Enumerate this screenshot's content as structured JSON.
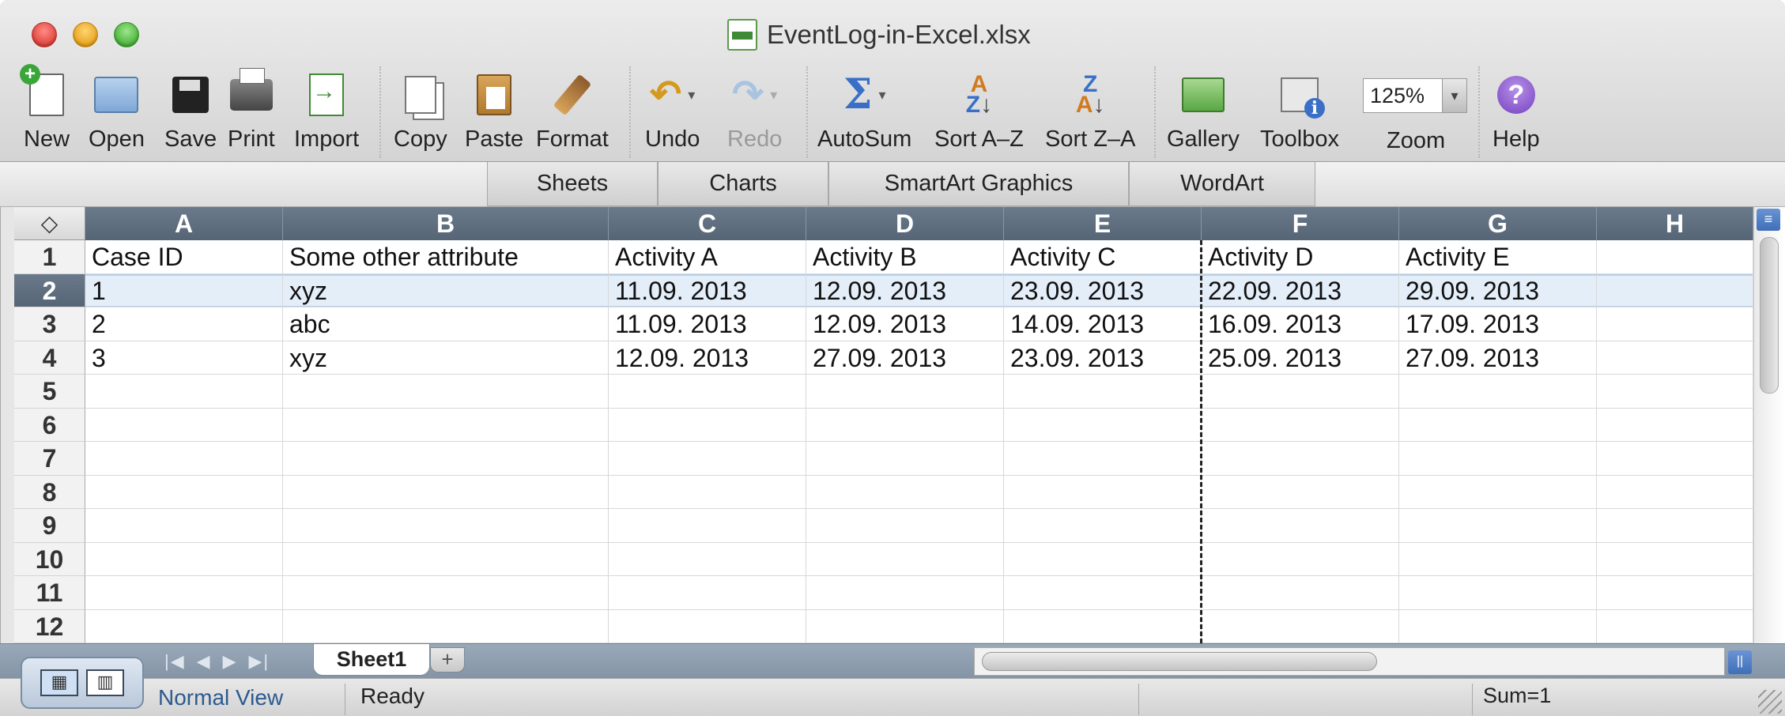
{
  "window": {
    "title": "EventLog-in-Excel.xlsx"
  },
  "toolbar": {
    "items": [
      {
        "label": "New",
        "icon": "new-document-icon"
      },
      {
        "label": "Open",
        "icon": "open-folder-icon"
      },
      {
        "label": "Save",
        "icon": "save-floppy-icon"
      },
      {
        "label": "Print",
        "icon": "printer-icon"
      },
      {
        "label": "Import",
        "icon": "import-icon"
      },
      {
        "label": "Copy",
        "icon": "copy-icon"
      },
      {
        "label": "Paste",
        "icon": "paste-icon"
      },
      {
        "label": "Format",
        "icon": "format-brush-icon"
      },
      {
        "label": "Undo",
        "icon": "undo-icon"
      },
      {
        "label": "Redo",
        "icon": "redo-icon",
        "disabled": true
      },
      {
        "label": "AutoSum",
        "icon": "autosum-sigma-icon"
      },
      {
        "label": "Sort A–Z",
        "icon": "sort-ascending-icon"
      },
      {
        "label": "Sort Z–A",
        "icon": "sort-descending-icon"
      },
      {
        "label": "Gallery",
        "icon": "gallery-icon"
      },
      {
        "label": "Toolbox",
        "icon": "toolbox-icon"
      },
      {
        "label": "Zoom",
        "icon": "zoom-select"
      },
      {
        "label": "Help",
        "icon": "help-icon"
      }
    ],
    "zoom_value": "125%"
  },
  "ribbon": {
    "tabs": [
      "Sheets",
      "Charts",
      "SmartArt Graphics",
      "WordArt"
    ]
  },
  "sheet": {
    "column_headers": [
      "A",
      "B",
      "C",
      "D",
      "E",
      "F",
      "G",
      "H"
    ],
    "row_numbers": [
      "1",
      "2",
      "3",
      "4",
      "5",
      "6",
      "7",
      "8",
      "9",
      "10",
      "11",
      "12"
    ],
    "selected_row": "2",
    "rows": [
      [
        "Case ID",
        "Some other attribute",
        "Activity A",
        "Activity B",
        "Activity C",
        "Activity D",
        "Activity E",
        ""
      ],
      [
        "1",
        "xyz",
        "11.09. 2013",
        "12.09. 2013",
        "23.09. 2013",
        "22.09. 2013",
        "29.09. 2013",
        ""
      ],
      [
        "2",
        "abc",
        "11.09. 2013",
        "12.09. 2013",
        "14.09. 2013",
        "16.09. 2013",
        "17.09. 2013",
        ""
      ],
      [
        "3",
        "xyz",
        "12.09. 2013",
        "27.09. 2013",
        "23.09. 2013",
        "25.09. 2013",
        "27.09. 2013",
        ""
      ]
    ]
  },
  "tabs": {
    "active": "Sheet1",
    "add": "+"
  },
  "status": {
    "view": "Normal View",
    "state": "Ready",
    "sum": "Sum=1"
  },
  "colors": {
    "header_bg": "#5f6f80",
    "selection": "#e4eef9",
    "accent": "#3f6fb8"
  }
}
